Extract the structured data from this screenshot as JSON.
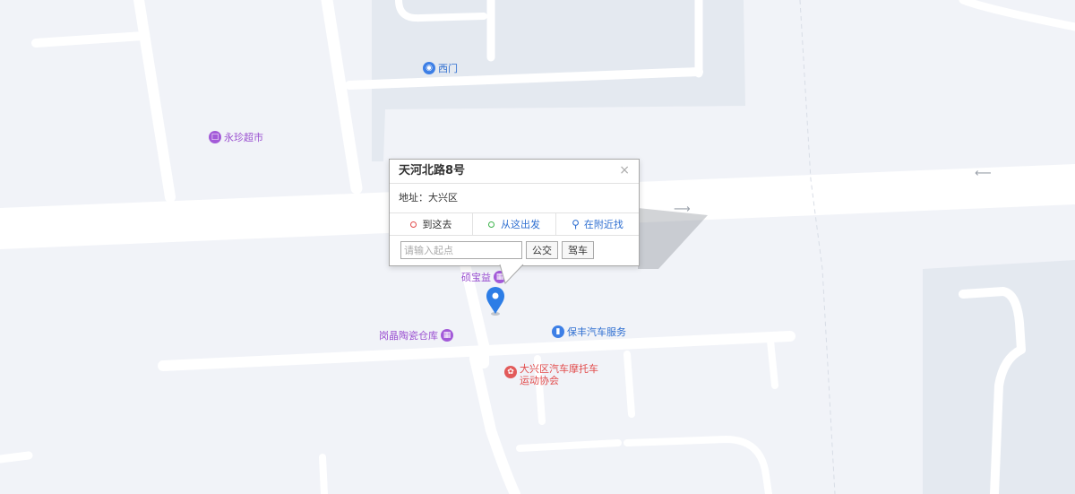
{
  "map": {
    "colors": {
      "background": "#f1f3f8",
      "road": "#ffffff",
      "block": "#e4e9f0",
      "marker": "#2d7de6"
    },
    "pois": [
      {
        "id": "ximen",
        "label": "西门",
        "icon": "transit-icon",
        "style": "blue"
      },
      {
        "id": "yongzhen",
        "label": "永珍超市",
        "icon": "shopping-cart-icon",
        "style": "purple"
      },
      {
        "id": "shuobaoyi",
        "label": "硕宝益",
        "icon": "shop-icon",
        "style": "purple"
      },
      {
        "id": "gangjing",
        "label": "岗晶陶瓷仓库",
        "icon": "shop-icon",
        "style": "purple"
      },
      {
        "id": "baofeng",
        "label": "保丰汽车服务",
        "icon": "car-icon",
        "style": "blue"
      },
      {
        "id": "motor_assoc",
        "label_line1": "大兴区汽车摩托车",
        "label_line2": "运动协会",
        "icon": "sports-icon",
        "style": "red"
      }
    ]
  },
  "infowindow": {
    "title": "天河北路8号",
    "close_symbol": "×",
    "address_label": "地址：",
    "address_value": "大兴区",
    "tabs": [
      {
        "label": "到这去",
        "icon": "red-dot-icon",
        "color": "#e24b4b"
      },
      {
        "label": "从这出发",
        "icon": "green-dot-icon",
        "color": "#3cb34a"
      },
      {
        "label": "在附近找",
        "icon": "search-nearby-icon",
        "color": "#2f6fd1"
      }
    ],
    "input_placeholder": "请输入起点",
    "bus_label": "公交",
    "drive_label": "驾车"
  }
}
